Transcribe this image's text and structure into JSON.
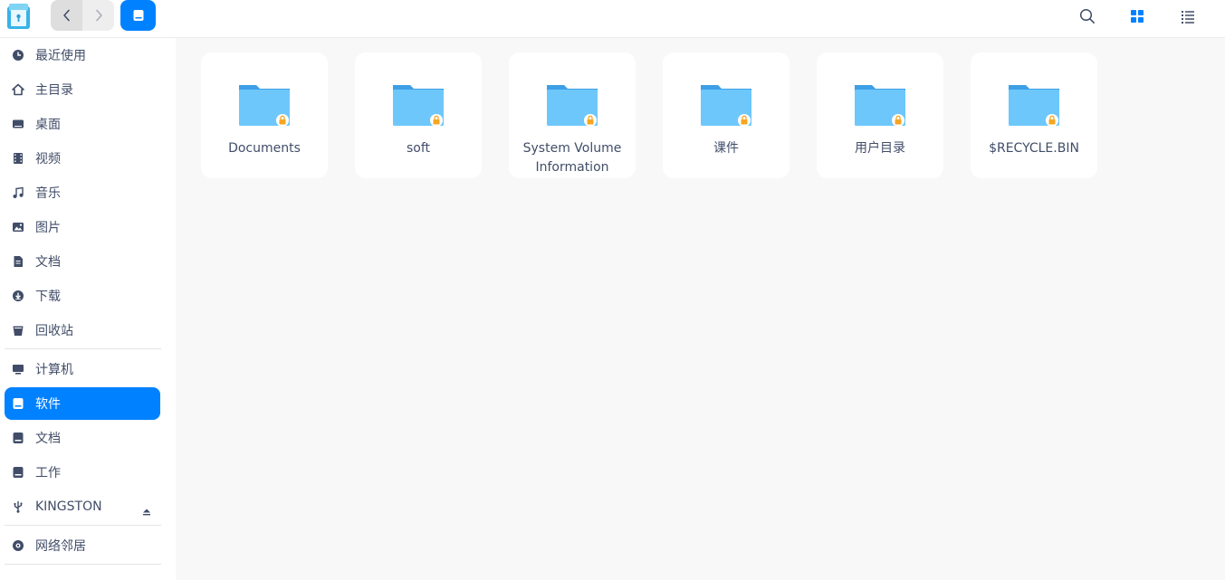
{
  "toolbar": {
    "back_icon": "chevron-left-icon",
    "forward_icon": "chevron-right-icon",
    "current_location_icon": "disk-icon",
    "search_icon": "search-icon",
    "icon_view_icon": "grid-view-icon",
    "list_view_icon": "list-view-icon",
    "accent_color": "#0081ff"
  },
  "sidebar": {
    "items": [
      {
        "label": "最近使用",
        "icon": "clock-icon"
      },
      {
        "label": "主目录",
        "icon": "home-icon"
      },
      {
        "label": "桌面",
        "icon": "desktop-icon"
      },
      {
        "label": "视频",
        "icon": "video-icon"
      },
      {
        "label": "音乐",
        "icon": "music-icon"
      },
      {
        "label": "图片",
        "icon": "picture-icon"
      },
      {
        "label": "文档",
        "icon": "document-icon"
      },
      {
        "label": "下载",
        "icon": "download-icon"
      },
      {
        "label": "回收站",
        "icon": "trash-icon"
      },
      {
        "label": "计算机",
        "icon": "computer-icon"
      },
      {
        "label": "软件",
        "icon": "disk-icon",
        "active": true
      },
      {
        "label": "文档",
        "icon": "disk-icon"
      },
      {
        "label": "工作",
        "icon": "disk-icon"
      },
      {
        "label": "KINGSTON",
        "icon": "usb-icon",
        "eject": true
      },
      {
        "label": "网络邻居",
        "icon": "network-icon"
      }
    ]
  },
  "content": {
    "items": [
      {
        "name": "Documents",
        "locked": true
      },
      {
        "name": "soft",
        "locked": true
      },
      {
        "name": "System Volume Information",
        "locked": true
      },
      {
        "name": "课件",
        "locked": true
      },
      {
        "name": "用户目录",
        "locked": true
      },
      {
        "name": "$RECYCLE.BIN",
        "locked": true
      }
    ]
  }
}
